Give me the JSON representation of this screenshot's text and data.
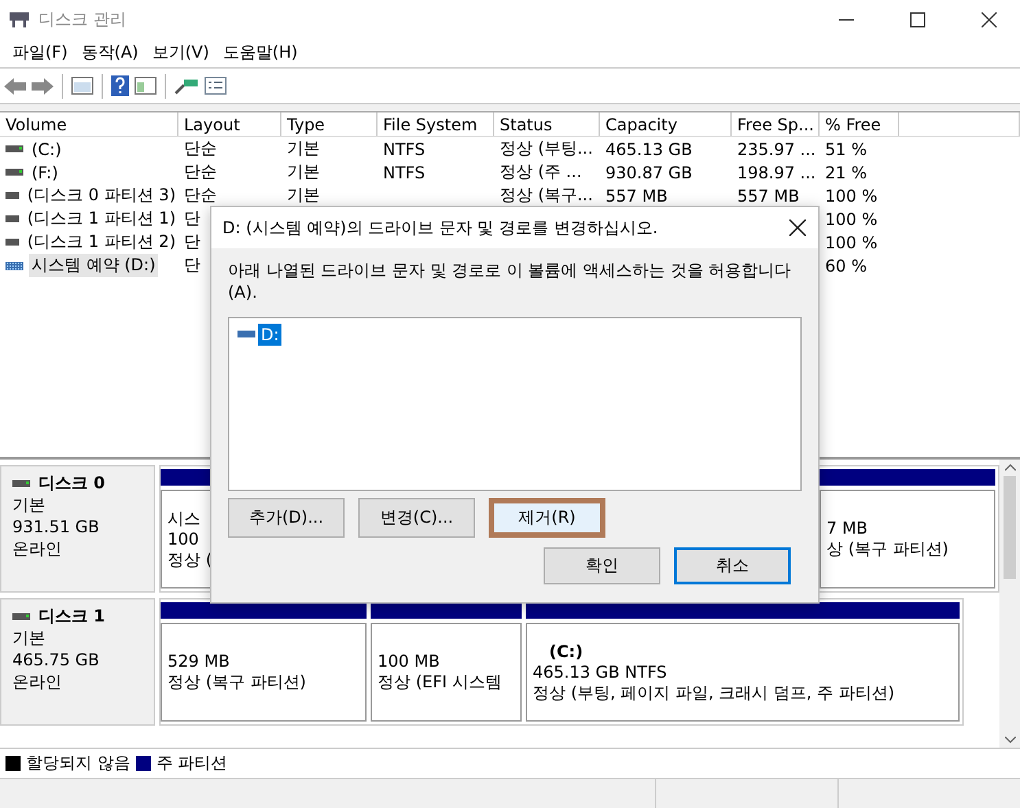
{
  "window": {
    "title": "디스크 관리"
  },
  "menu": [
    "파일(F)",
    "동작(A)",
    "보기(V)",
    "도움말(H)"
  ],
  "table": {
    "columns": [
      "Volume",
      "Layout",
      "Type",
      "File System",
      "Status",
      "Capacity",
      "Free Sp...",
      "% Free"
    ],
    "rows": [
      {
        "kind": "drive",
        "selected": false,
        "volume": "(C:)",
        "layout": "단순",
        "type": "기본",
        "fs": "NTFS",
        "status": "정상 (부팅...",
        "capacity": "465.13 GB",
        "free": "235.97 ...",
        "pct": "51 %"
      },
      {
        "kind": "drive",
        "selected": false,
        "volume": "(F:)",
        "layout": "단순",
        "type": "기본",
        "fs": "NTFS",
        "status": "정상 (주 ...",
        "capacity": "930.87 GB",
        "free": "198.97 ...",
        "pct": "21 %"
      },
      {
        "kind": "drive",
        "selected": false,
        "volume": "(디스크 0 파티션 3)",
        "layout": "단순",
        "type": "기본",
        "status": "정상 (복구...",
        "capacity": "557 MB",
        "free": "557 MB",
        "pct": "100 %"
      },
      {
        "kind": "drive",
        "selected": false,
        "volume": "(디스크 1 파티션 1)",
        "layout": "단",
        "pct": "100 %"
      },
      {
        "kind": "drive",
        "selected": false,
        "volume": "(디스크 1 파티션 2)",
        "layout": "단",
        "pct": "100 %"
      },
      {
        "kind": "reserved",
        "selected": true,
        "volume": "시스템 예약 (D:)",
        "layout": "단",
        "pct": "60 %"
      }
    ]
  },
  "disks": [
    {
      "name": "디스크 0",
      "type": "기본",
      "size": "931.51 GB",
      "state": "온라인",
      "partitions": [
        {
          "lines": [
            "시스",
            "100",
            "정상 ("
          ]
        },
        {
          "lines": [
            "7 MB",
            "상 (복구 파티션)"
          ]
        }
      ]
    },
    {
      "name": "디스크 1",
      "type": "기본",
      "size": "465.75 GB",
      "state": "온라인",
      "partitions": [
        {
          "lines": [
            "529 MB",
            "정상 (복구 파티션)"
          ]
        },
        {
          "lines": [
            "100 MB",
            "정상 (EFI 시스템"
          ]
        },
        {
          "title": "(C:)",
          "lines": [
            "465.13 GB NTFS",
            "정상 (부팅, 페이지 파일, 크래시 덤프, 주 파티션)"
          ]
        }
      ]
    }
  ],
  "legend": [
    {
      "label": "할당되지 않음",
      "color": "#000000"
    },
    {
      "label": "주 파티션",
      "color": "#000080"
    }
  ],
  "dialog": {
    "title": "D: (시스템 예약)의 드라이브 문자 및 경로를 변경하십시오.",
    "description": "아래 나열된 드라이브 문자 및 경로로 이 볼륨에 액세스하는 것을 허용합니다 (A).",
    "items": [
      {
        "label": "D:",
        "selected": true
      }
    ],
    "buttons": [
      {
        "label": "추가(D)...",
        "highlighted": false
      },
      {
        "label": "변경(C)...",
        "highlighted": false
      },
      {
        "label": "제거(R)",
        "highlighted": true
      }
    ],
    "actions": [
      {
        "label": "확인",
        "default": false
      },
      {
        "label": "취소",
        "default": true
      }
    ]
  }
}
